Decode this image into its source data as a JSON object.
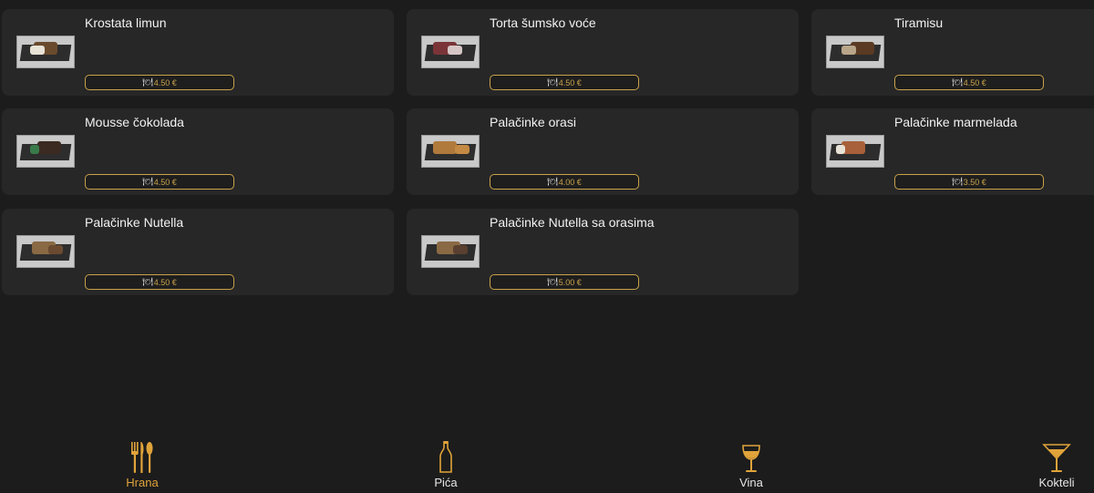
{
  "colors": {
    "accent": "#e0a33a",
    "price_border": "#c9a24a",
    "card_bg": "#272727",
    "page_bg": "#1c1c1c"
  },
  "items": [
    {
      "name": "Krostata limun",
      "price": "4.50 €",
      "icon": "cutlery-icon"
    },
    {
      "name": "Torta šumsko voće",
      "price": "4.50 €",
      "icon": "cutlery-icon"
    },
    {
      "name": "Tiramisu",
      "price": "4.50 €",
      "icon": "cutlery-icon"
    },
    {
      "name": "Mousse čokolada",
      "price": "4.50 €",
      "icon": "cutlery-icon"
    },
    {
      "name": "Palačinke orasi",
      "price": "4.00 €",
      "icon": "cutlery-icon"
    },
    {
      "name": "Palačinke marmelada",
      "price": "3.50 €",
      "icon": "cutlery-icon"
    },
    {
      "name": "Palačinke Nutella",
      "price": "4.50 €",
      "icon": "cutlery-icon"
    },
    {
      "name": "Palačinke Nutella sa orasima",
      "price": "5.00 €",
      "icon": "cutlery-icon"
    }
  ],
  "nav": [
    {
      "label": "Hrana",
      "icon": "fork-knife-icon",
      "active": true
    },
    {
      "label": "Pića",
      "icon": "bottle-icon",
      "active": false
    },
    {
      "label": "Vina",
      "icon": "wine-glass-icon",
      "active": false
    },
    {
      "label": "Kokteli",
      "icon": "cocktail-icon",
      "active": false
    }
  ]
}
